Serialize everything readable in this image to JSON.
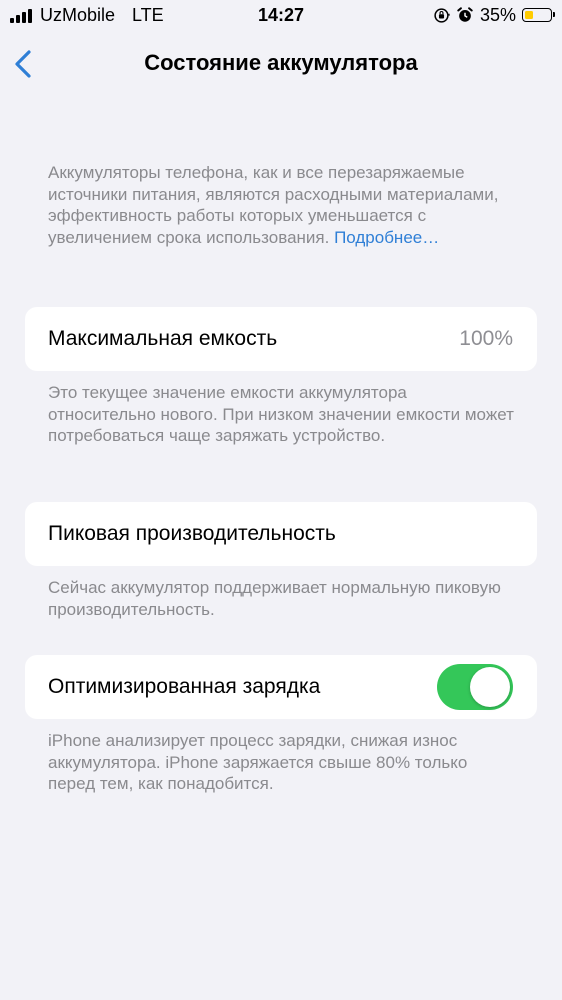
{
  "status_bar": {
    "carrier": "UzMobile",
    "network": "LTE",
    "time": "14:27",
    "battery_percent": "35%",
    "battery_level": 0.35,
    "battery_color": "#ffcc00"
  },
  "nav": {
    "title": "Состояние аккумулятора",
    "back_icon": "chevron-left-icon"
  },
  "intro": {
    "text": "Аккумуляторы телефона, как и все перезаряжаемые источники питания, являются расходными материалами, эффективность работы которых уменьшается с увеличением срока использования. ",
    "link": "Подробнее…"
  },
  "max_capacity": {
    "label": "Максимальная емкость",
    "value": "100%",
    "footnote": "Это текущее значение емкости аккумулятора относительно нового. При низком значении емкости может потребоваться чаще заряжать устройство."
  },
  "peak_performance": {
    "label": "Пиковая производительность",
    "footnote": "Сейчас аккумулятор поддерживает нормальную пиковую производительность."
  },
  "optimized_charging": {
    "label": "Оптимизированная зарядка",
    "enabled": true,
    "toggle_color": "#34c759",
    "footnote": "iPhone анализирует процесс зарядки, снижая износ аккумулятора. iPhone заряжается свыше 80% только перед тем, как понадобится."
  },
  "colors": {
    "background": "#f2f2f7",
    "link": "#2f7fd6",
    "secondary_text": "#8a8a8e"
  }
}
